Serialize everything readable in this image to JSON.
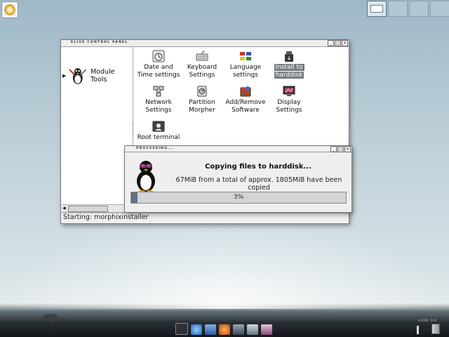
{
  "desktop": {
    "pager": {
      "workspaces": 4,
      "active": 1
    }
  },
  "control_panel": {
    "title": "ELIVE CONTROL PANEL",
    "title_buttons": [
      "_",
      "□",
      "×"
    ],
    "left_pane": {
      "tree_item_label": "Module Tools"
    },
    "modules": [
      {
        "label1": "Date and",
        "label2": "Time settings",
        "icon": "clock-icon"
      },
      {
        "label1": "Keyboard",
        "label2": "Settings",
        "icon": "keyboard-icon"
      },
      {
        "label1": "Language",
        "label2": "settings",
        "icon": "language-icon"
      },
      {
        "label1": "Install to",
        "label2": "harddisk",
        "icon": "install-icon",
        "selected": true
      },
      {
        "label1": "Network",
        "label2": "Settings",
        "icon": "network-icon"
      },
      {
        "label1": "Partition",
        "label2": "Morpher",
        "icon": "partition-icon"
      },
      {
        "label1": "Add/Remove",
        "label2": "Software",
        "icon": "software-icon"
      },
      {
        "label1": "Display",
        "label2": "Settings",
        "icon": "display-icon"
      },
      {
        "label1": "Root terminal",
        "label2": "",
        "icon": "terminal-icon"
      }
    ],
    "status_text": "Starting: morphixinstaller"
  },
  "processing_dialog": {
    "title": "PROCESSING...",
    "title_buttons": [
      "_",
      "□",
      "×"
    ],
    "heading": "Copying files to harddisk...",
    "message": "67MiB from a total of approx. 1805MiB have been copied",
    "progress_label": "3%",
    "progress_fraction": 0.03
  },
  "tray": {
    "caption": "HOME DIR",
    "trash_icon": "trash-icon"
  },
  "colors": {
    "selection": "#777b80",
    "progress_fill": "#5f7283"
  }
}
